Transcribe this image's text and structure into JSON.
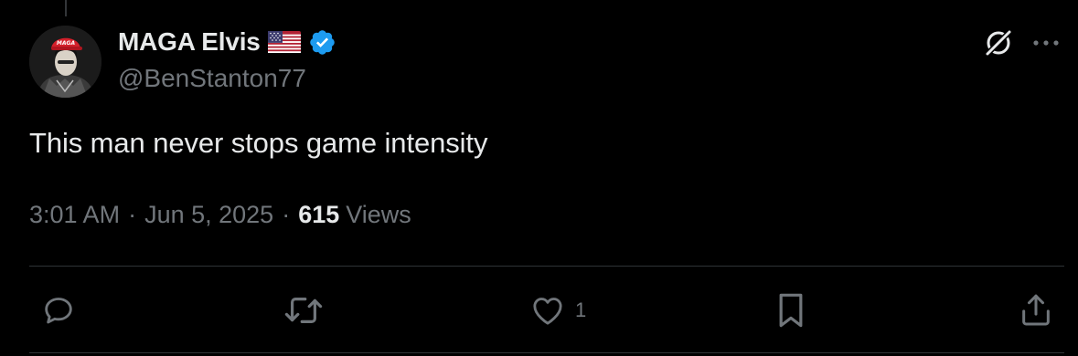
{
  "tweet": {
    "author": {
      "display_name": "MAGA Elvis",
      "handle": "@BenStanton77",
      "flag_icon": "us-flag-icon",
      "verified_icon": "verified-badge-icon",
      "verified_color": "#1d9bf0",
      "avatar_cap_text": "MAGA"
    },
    "text": "This man never stops game intensity",
    "meta": {
      "time": "3:01 AM",
      "separator": "·",
      "date": "Jun 5, 2025",
      "views_count": "615",
      "views_label": "Views"
    },
    "actions": {
      "reply_icon": "reply-icon",
      "repost_icon": "repost-icon",
      "like_icon": "heart-icon",
      "like_count": "1",
      "bookmark_icon": "bookmark-icon",
      "share_icon": "share-icon"
    },
    "header_buttons": {
      "grok_icon": "grok-icon",
      "more_icon": "more-horizontal-icon"
    }
  },
  "theme": {
    "background": "#000000",
    "text_primary": "#e7e9ea",
    "text_secondary": "#71767b",
    "divider": "#2f3336"
  }
}
